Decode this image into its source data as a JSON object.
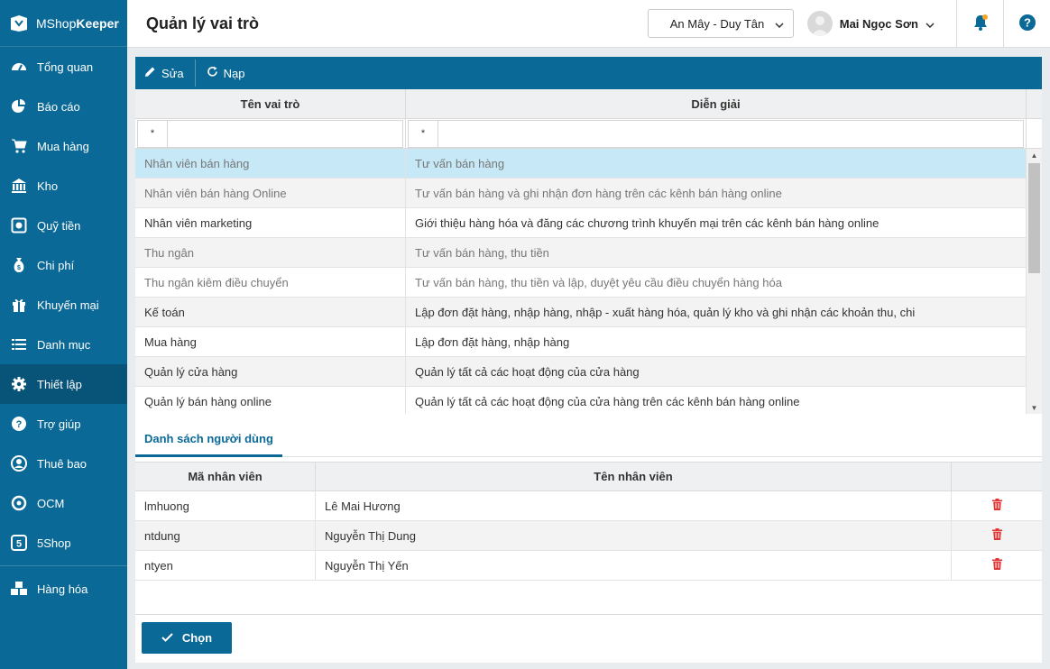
{
  "app": {
    "brand_plain": "MShop",
    "brand_bold": "Keeper"
  },
  "sidebar": {
    "items": [
      {
        "label": "Tổng quan",
        "icon": "dashboard-icon"
      },
      {
        "label": "Báo cáo",
        "icon": "pie-chart-icon"
      },
      {
        "label": "Mua hàng",
        "icon": "cart-icon"
      },
      {
        "label": "Kho",
        "icon": "warehouse-icon"
      },
      {
        "label": "Quỹ tiền",
        "icon": "safe-icon"
      },
      {
        "label": "Chi phí",
        "icon": "money-bag-icon"
      },
      {
        "label": "Khuyến mại",
        "icon": "gift-icon"
      },
      {
        "label": "Danh mục",
        "icon": "list-icon"
      },
      {
        "label": "Thiết lập",
        "icon": "gear-icon",
        "active": true
      },
      {
        "label": "Trợ giúp",
        "icon": "help-icon"
      },
      {
        "label": "Thuê bao",
        "icon": "user-circle-icon"
      },
      {
        "label": "OCM",
        "icon": "ocm-icon"
      },
      {
        "label": "5Shop",
        "icon": "5shop-icon"
      },
      {
        "label": "Hàng hóa",
        "icon": "boxes-icon"
      }
    ]
  },
  "header": {
    "title": "Quản lý vai trò",
    "branch": "An Mây - Duy Tân",
    "user": "Mai Ngọc Sơn"
  },
  "toolbar": {
    "edit_label": "Sửa",
    "reload_label": "Nạp"
  },
  "roles_grid": {
    "columns": [
      "Tên vai trò",
      "Diễn giải"
    ],
    "filter_op": "*",
    "rows": [
      {
        "name": "Nhân viên bán hàng",
        "desc": "Tư vấn bán hàng"
      },
      {
        "name": "Nhân viên bán hàng Online",
        "desc": "Tư vấn bán hàng và ghi nhận đơn hàng trên các kênh bán hàng online"
      },
      {
        "name": "Nhân viên marketing",
        "desc": "Giới thiệu hàng hóa và đăng các chương trình khuyến mại trên các kênh bán hàng online"
      },
      {
        "name": "Thu ngân",
        "desc": "Tư vấn bán hàng, thu tiền"
      },
      {
        "name": "Thu ngân kiêm điều chuyển",
        "desc": "Tư vấn bán hàng, thu tiền và lập, duyệt yêu cầu điều chuyển hàng hóa"
      },
      {
        "name": "Kế toán",
        "desc": "Lập đơn đặt hàng, nhập hàng, nhập - xuất hàng hóa, quản lý kho và ghi nhận các khoản thu, chi"
      },
      {
        "name": "Mua hàng",
        "desc": "Lập đơn đặt hàng, nhập hàng"
      },
      {
        "name": "Quản lý cửa hàng",
        "desc": "Quản lý tất cả các hoạt động của cửa hàng"
      },
      {
        "name": "Quản lý bán hàng online",
        "desc": "Quản lý tất cả các hoạt động của cửa hàng trên các kênh bán hàng online"
      }
    ]
  },
  "users_tab": {
    "label": "Danh sách người dùng"
  },
  "users_grid": {
    "columns": [
      "Mã nhân viên",
      "Tên nhân viên"
    ],
    "rows": [
      {
        "code": "lmhuong",
        "name": "Lê Mai Hương"
      },
      {
        "code": "ntdung",
        "name": "Nguyễn Thị Dung"
      },
      {
        "code": "ntyen",
        "name": "Nguyễn Thị Yến"
      }
    ]
  },
  "footer": {
    "choose_label": "Chọn"
  },
  "colors": {
    "primary": "#0a6996",
    "selected_row": "#c6e8f7",
    "delete": "#e03434",
    "bell_dot": "#f5a623"
  }
}
